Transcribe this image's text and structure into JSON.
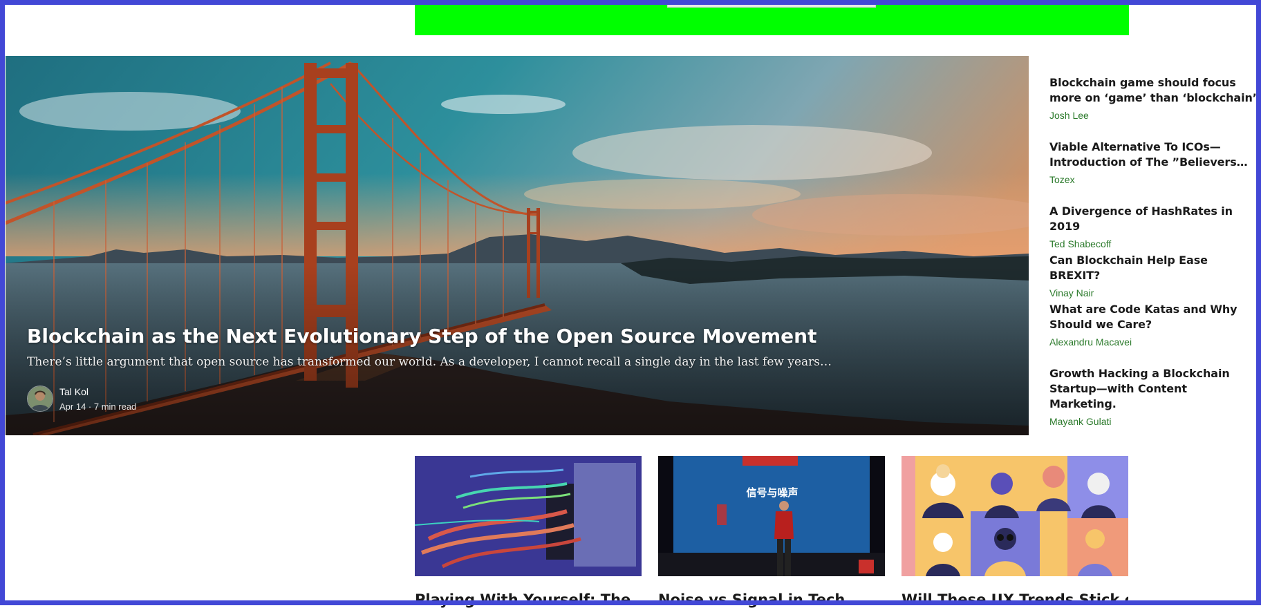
{
  "hero": {
    "title": "Blockchain as the Next Evolutionary Step of the Open Source Movement",
    "excerpt": "There’s little argument that open source has transformed our world. As a developer, I cannot recall a single day in the last few years…",
    "author": "Tal Kol",
    "meta": "Apr 14 · 7 min read"
  },
  "sidebar": {
    "items": [
      {
        "title": "Blockchain game should focus more on ‘game’ than ‘blockchain’",
        "author": "Josh Lee"
      },
      {
        "title": "Viable Alternative To ICOs—Introduction of The ”Believers…",
        "author": "Tozex"
      },
      {
        "title": "A Divergence of HashRates in 2019",
        "author": "Ted Shabecoff"
      },
      {
        "title": "Can Blockchain Help Ease BREXIT?",
        "author": "Vinay Nair"
      },
      {
        "title": "What are Code Katas and Why Should we Care?",
        "author": "Alexandru Macavei"
      },
      {
        "title": "Growth Hacking a Blockchain Startup—with Content Marketing.",
        "author": "Mayank Gulati"
      }
    ]
  },
  "cards": [
    {
      "title": "Playing With Yourself: The"
    },
    {
      "title": "Noise vs Signal in Tech",
      "image_text": "信号与噪声"
    },
    {
      "title": "Will These UX Trends Stick or"
    }
  ],
  "colors": {
    "frame": "#4248d6",
    "ad_banner": "#00ff00",
    "author_link": "#2b7a2b"
  }
}
